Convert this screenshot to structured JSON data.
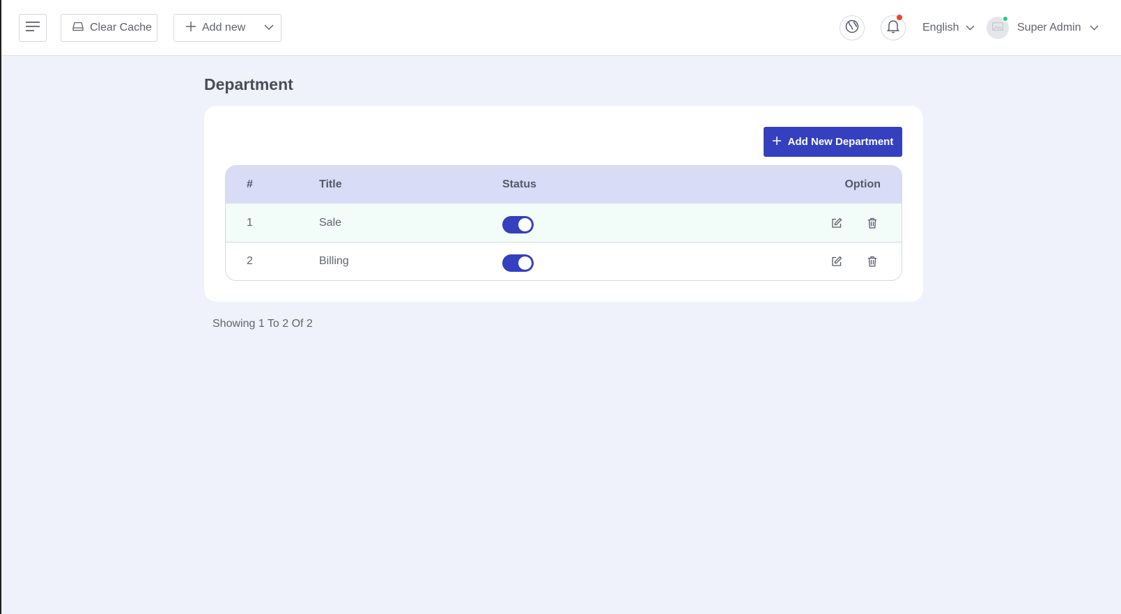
{
  "topbar": {
    "clear_cache_label": "Clear Cache",
    "add_new_label": "Add new",
    "language": "English",
    "user_name": "Super Admin"
  },
  "page": {
    "title": "Department",
    "add_button_label": "Add New Department"
  },
  "table": {
    "headers": {
      "num": "#",
      "title": "Title",
      "status": "Status",
      "option": "Option"
    },
    "rows": [
      {
        "num": "1",
        "title": "Sale",
        "status": true
      },
      {
        "num": "2",
        "title": "Billing",
        "status": true
      }
    ]
  },
  "pagination": {
    "summary": "Showing 1 To 2 Of 2"
  },
  "colors": {
    "accent": "#3440bf",
    "header_bg": "#d9dcf6",
    "page_bg": "#eff2fa",
    "notification_dot": "#f0442c",
    "online_dot": "#1ecb87"
  }
}
